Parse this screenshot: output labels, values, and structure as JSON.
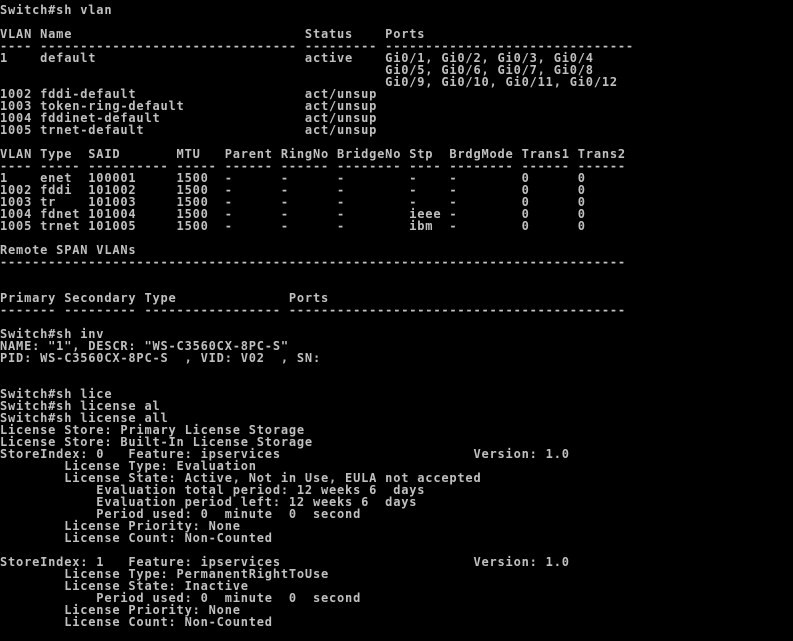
{
  "terminal": {
    "lines": [
      "Switch#sh vlan",
      "",
      "VLAN Name                             Status    Ports",
      "---- -------------------------------- --------- -------------------------------",
      "1    default                          active    Gi0/1, Gi0/2, Gi0/3, Gi0/4",
      "                                                Gi0/5, Gi0/6, Gi0/7, Gi0/8",
      "                                                Gi0/9, Gi0/10, Gi0/11, Gi0/12",
      "1002 fddi-default                     act/unsup",
      "1003 token-ring-default               act/unsup",
      "1004 fddinet-default                  act/unsup",
      "1005 trnet-default                    act/unsup",
      "",
      "VLAN Type  SAID       MTU   Parent RingNo BridgeNo Stp  BrdgMode Trans1 Trans2",
      "---- ----- ---------- ----- ------ ------ -------- ---- -------- ------ ------",
      "1    enet  100001     1500  -      -      -        -    -        0      0",
      "1002 fddi  101002     1500  -      -      -        -    -        0      0",
      "1003 tr    101003     1500  -      -      -        -    -        0      0",
      "1004 fdnet 101004     1500  -      -      -        ieee -        0      0",
      "1005 trnet 101005     1500  -      -      -        ibm  -        0      0",
      "",
      "Remote SPAN VLANs",
      "------------------------------------------------------------------------------",
      "",
      "",
      "Primary Secondary Type              Ports",
      "------- --------- ----------------- ------------------------------------------",
      "",
      "Switch#sh inv",
      "NAME: \"1\", DESCR: \"WS-C3560CX-8PC-S\"",
      "PID: WS-C3560CX-8PC-S  , VID: V02  , SN:",
      "",
      "",
      "Switch#sh lice",
      "Switch#sh license al",
      "Switch#sh license all",
      "License Store: Primary License Storage",
      "License Store: Built-In License Storage",
      "StoreIndex: 0   Feature: ipservices                        Version: 1.0",
      "        License Type: Evaluation",
      "        License State: Active, Not in Use, EULA not accepted",
      "            Evaluation total period: 12 weeks 6  days",
      "            Evaluation period left: 12 weeks 6  days",
      "            Period used: 0  minute  0  second",
      "        License Priority: None",
      "        License Count: Non-Counted",
      "",
      "StoreIndex: 1   Feature: ipservices                        Version: 1.0",
      "        License Type: PermanentRightToUse",
      "        License State: Inactive",
      "            Period used: 0  minute  0  second",
      "        License Priority: None",
      "        License Count: Non-Counted",
      ""
    ]
  }
}
